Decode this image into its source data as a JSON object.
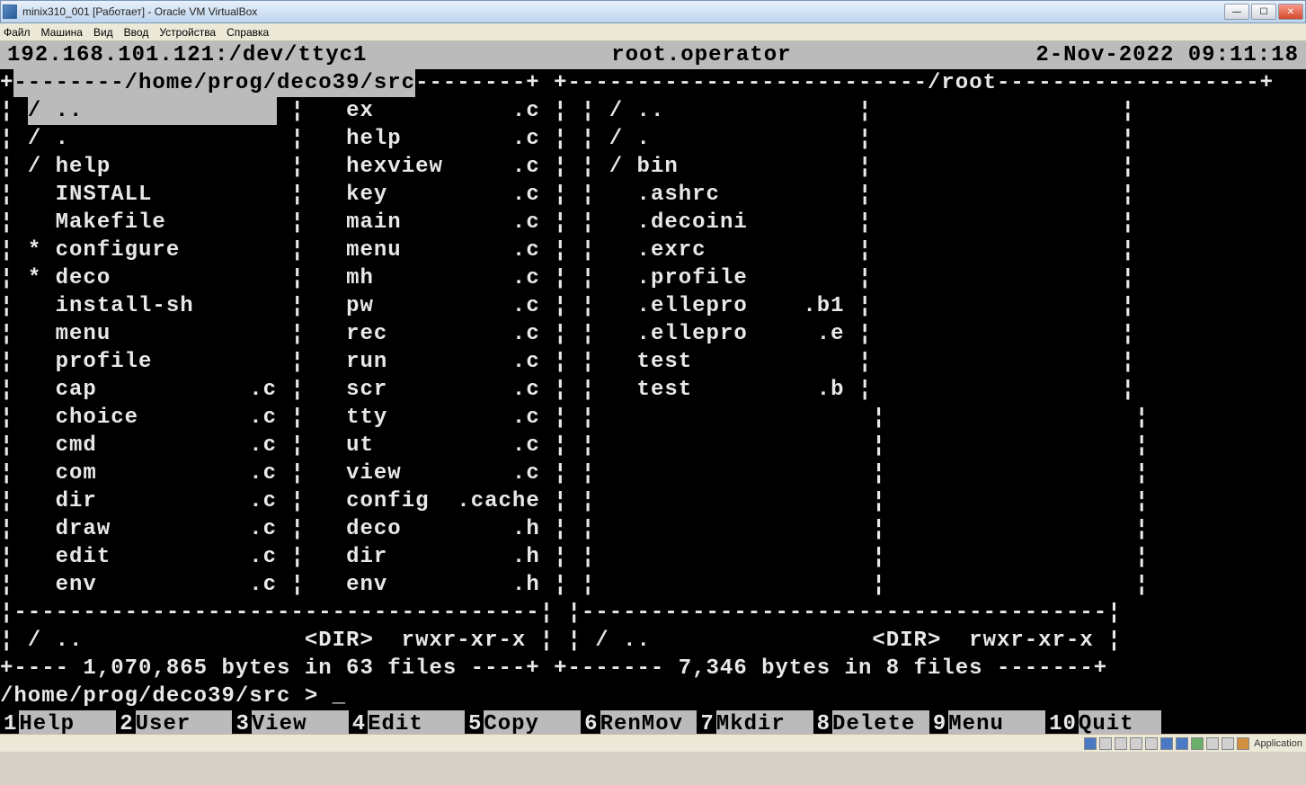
{
  "window": {
    "title": "minix310_001 [Работает] - Oracle VM VirtualBox"
  },
  "menubar": [
    "Файл",
    "Машина",
    "Вид",
    "Ввод",
    "Устройства",
    "Справка"
  ],
  "header": {
    "host": "192.168.101.121:/dev/ttyc1",
    "user": "root.operator",
    "datetime": "2-Nov-2022 09:11:18"
  },
  "left_panel": {
    "path": "/home/prog/deco39/src",
    "col1": [
      {
        "pre": "/",
        "name": "..",
        "ext": "",
        "sel": true
      },
      {
        "pre": "/",
        "name": ".",
        "ext": ""
      },
      {
        "pre": "/",
        "name": "help",
        "ext": ""
      },
      {
        "pre": " ",
        "name": "INSTALL",
        "ext": ""
      },
      {
        "pre": " ",
        "name": "Makefile",
        "ext": ""
      },
      {
        "pre": "*",
        "name": "configure",
        "ext": ""
      },
      {
        "pre": "*",
        "name": "deco",
        "ext": ""
      },
      {
        "pre": " ",
        "name": "install-sh",
        "ext": ""
      },
      {
        "pre": " ",
        "name": "menu",
        "ext": ""
      },
      {
        "pre": " ",
        "name": "profile",
        "ext": ""
      },
      {
        "pre": " ",
        "name": "cap",
        "ext": ".c"
      },
      {
        "pre": " ",
        "name": "choice",
        "ext": ".c"
      },
      {
        "pre": " ",
        "name": "cmd",
        "ext": ".c"
      },
      {
        "pre": " ",
        "name": "com",
        "ext": ".c"
      },
      {
        "pre": " ",
        "name": "dir",
        "ext": ".c"
      },
      {
        "pre": " ",
        "name": "draw",
        "ext": ".c"
      },
      {
        "pre": " ",
        "name": "edit",
        "ext": ".c"
      },
      {
        "pre": " ",
        "name": "env",
        "ext": ".c"
      }
    ],
    "col2": [
      {
        "pre": " ",
        "name": "ex",
        "ext": ".c"
      },
      {
        "pre": " ",
        "name": "help",
        "ext": ".c"
      },
      {
        "pre": " ",
        "name": "hexview",
        "ext": ".c"
      },
      {
        "pre": " ",
        "name": "key",
        "ext": ".c"
      },
      {
        "pre": " ",
        "name": "main",
        "ext": ".c"
      },
      {
        "pre": " ",
        "name": "menu",
        "ext": ".c"
      },
      {
        "pre": " ",
        "name": "mh",
        "ext": ".c"
      },
      {
        "pre": " ",
        "name": "pw",
        "ext": ".c"
      },
      {
        "pre": " ",
        "name": "rec",
        "ext": ".c"
      },
      {
        "pre": " ",
        "name": "run",
        "ext": ".c"
      },
      {
        "pre": " ",
        "name": "scr",
        "ext": ".c"
      },
      {
        "pre": " ",
        "name": "tty",
        "ext": ".c"
      },
      {
        "pre": " ",
        "name": "ut",
        "ext": ".c"
      },
      {
        "pre": " ",
        "name": "view",
        "ext": ".c"
      },
      {
        "pre": " ",
        "name": "config",
        "ext": ".cache"
      },
      {
        "pre": " ",
        "name": "deco",
        "ext": ".h"
      },
      {
        "pre": " ",
        "name": "dir",
        "ext": ".h"
      },
      {
        "pre": " ",
        "name": "env",
        "ext": ".h"
      }
    ],
    "info": {
      "name": "/ ..",
      "type": "<DIR>",
      "perms": "rwxr-xr-x"
    },
    "summary": "1,070,865 bytes in 63 files"
  },
  "right_panel": {
    "path": "/root",
    "col1": [
      {
        "pre": "/",
        "name": "..",
        "ext": ""
      },
      {
        "pre": "/",
        "name": ".",
        "ext": ""
      },
      {
        "pre": "/",
        "name": "bin",
        "ext": ""
      },
      {
        "pre": " ",
        "name": ".ashrc",
        "ext": ""
      },
      {
        "pre": " ",
        "name": ".decoini",
        "ext": ""
      },
      {
        "pre": " ",
        "name": ".exrc",
        "ext": ""
      },
      {
        "pre": " ",
        "name": ".profile",
        "ext": ""
      },
      {
        "pre": " ",
        "name": ".ellepro",
        "ext": ".b1"
      },
      {
        "pre": " ",
        "name": ".ellepro",
        "ext": ".e"
      },
      {
        "pre": " ",
        "name": "test",
        "ext": ""
      },
      {
        "pre": " ",
        "name": "test",
        "ext": ".b"
      }
    ],
    "info": {
      "name": "/ ..",
      "type": "<DIR>",
      "perms": "rwxr-xr-x"
    },
    "summary": "7,346 bytes in 8 files"
  },
  "prompt": "/home/prog/deco39/src > _",
  "fnkeys": [
    {
      "n": "1",
      "label": "Help   "
    },
    {
      "n": "2",
      "label": "User   "
    },
    {
      "n": "3",
      "label": "View   "
    },
    {
      "n": "4",
      "label": "Edit   "
    },
    {
      "n": "5",
      "label": "Copy   "
    },
    {
      "n": "6",
      "label": "RenMov "
    },
    {
      "n": "7",
      "label": "Mkdir  "
    },
    {
      "n": "8",
      "label": "Delete "
    },
    {
      "n": "9",
      "label": "Menu   "
    },
    {
      "n": "10",
      "label": "Quit  "
    }
  ],
  "statusbar": {
    "app_label": "Application"
  }
}
